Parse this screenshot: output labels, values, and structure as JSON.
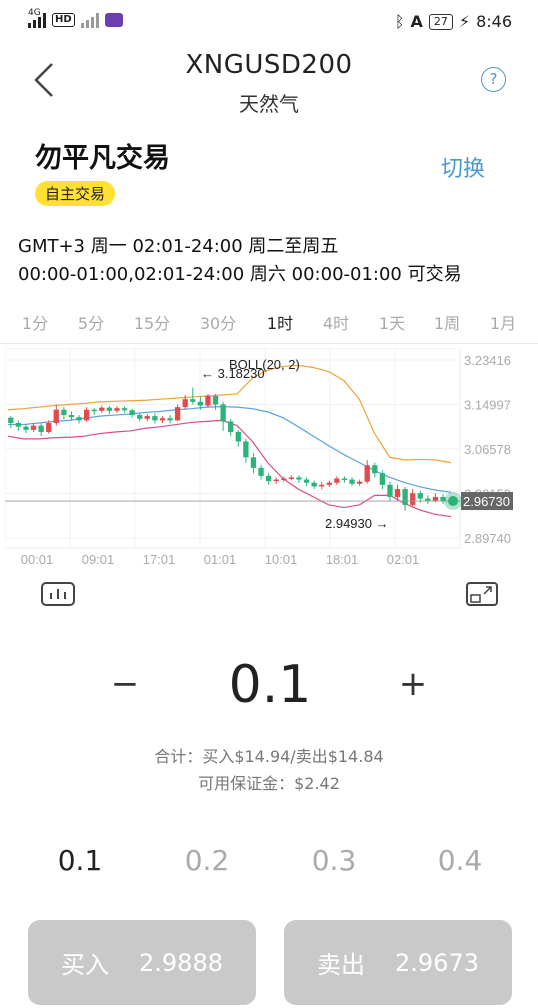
{
  "status_bar": {
    "network": "4G",
    "hd": "HD",
    "battery": "27",
    "time": "8:46"
  },
  "header": {
    "symbol": "XNGUSD200",
    "name": "天然气",
    "help": "?"
  },
  "instrument": {
    "title": "勿平凡交易",
    "switch_label": "切换",
    "badge": "自主交易",
    "hours_line1": "GMT+3 周一 02:01-24:00  周二至周五",
    "hours_line2": "00:00-01:00,02:01-24:00  周六 00:00-01:00 可交易"
  },
  "timeframes": [
    "1分",
    "5分",
    "15分",
    "30分",
    "1时",
    "4时",
    "1天",
    "1周",
    "1月"
  ],
  "active_timeframe": "1时",
  "chart_data": {
    "type": "candlestick",
    "indicator_label": "BOLL(20, 2)",
    "y_ticks": [
      "3.23416",
      "3.14997",
      "3.06578",
      "2.98159",
      "2.89740"
    ],
    "x_ticks": [
      "00:01",
      "09:01",
      "17:01",
      "01:01",
      "10:01",
      "18:01",
      "02:01"
    ],
    "high_annotation": "← 3.18230",
    "low_annotation": "2.94930 →",
    "current_price": "2.96730",
    "ylim": [
      2.8974,
      3.23416
    ],
    "colors": {
      "up": "#e24b4b",
      "down": "#2bb37a",
      "upper_band": "#f0a236",
      "middle_band": "#5aa2e0",
      "lower_band": "#d94c8a"
    },
    "candles": [
      [
        3.125,
        3.115,
        3.128,
        3.105
      ],
      [
        3.115,
        3.108,
        3.12,
        3.1
      ],
      [
        3.108,
        3.102,
        3.113,
        3.096
      ],
      [
        3.102,
        3.11,
        3.115,
        3.098
      ],
      [
        3.11,
        3.098,
        3.114,
        3.09
      ],
      [
        3.098,
        3.115,
        3.12,
        3.095
      ],
      [
        3.115,
        3.14,
        3.15,
        3.11
      ],
      [
        3.14,
        3.13,
        3.145,
        3.122
      ],
      [
        3.13,
        3.126,
        3.137,
        3.12
      ],
      [
        3.126,
        3.12,
        3.13,
        3.114
      ],
      [
        3.12,
        3.14,
        3.145,
        3.117
      ],
      [
        3.14,
        3.138,
        3.143,
        3.13
      ],
      [
        3.138,
        3.144,
        3.148,
        3.134
      ],
      [
        3.144,
        3.138,
        3.147,
        3.132
      ],
      [
        3.138,
        3.143,
        3.147,
        3.134
      ],
      [
        3.143,
        3.139,
        3.146,
        3.134
      ],
      [
        3.139,
        3.13,
        3.142,
        3.125
      ],
      [
        3.13,
        3.123,
        3.134,
        3.118
      ],
      [
        3.123,
        3.128,
        3.132,
        3.118
      ],
      [
        3.128,
        3.12,
        3.133,
        3.114
      ],
      [
        3.12,
        3.124,
        3.128,
        3.115
      ],
      [
        3.124,
        3.12,
        3.13,
        3.114
      ],
      [
        3.12,
        3.145,
        3.15,
        3.118
      ],
      [
        3.145,
        3.16,
        3.168,
        3.14
      ],
      [
        3.16,
        3.155,
        3.182,
        3.15
      ],
      [
        3.155,
        3.148,
        3.165,
        3.14
      ],
      [
        3.148,
        3.166,
        3.17,
        3.144
      ],
      [
        3.166,
        3.15,
        3.17,
        3.14
      ],
      [
        3.15,
        3.118,
        3.155,
        3.1
      ],
      [
        3.118,
        3.098,
        3.122,
        3.09
      ],
      [
        3.098,
        3.08,
        3.102,
        3.07
      ],
      [
        3.08,
        3.05,
        3.085,
        3.04
      ],
      [
        3.05,
        3.03,
        3.058,
        3.02
      ],
      [
        3.03,
        3.015,
        3.036,
        3.008
      ],
      [
        3.015,
        3.005,
        3.02,
        2.998
      ],
      [
        3.005,
        3.008,
        3.012,
        3.0
      ],
      [
        3.008,
        3.01,
        3.014,
        3.004
      ],
      [
        3.01,
        3.012,
        3.016,
        3.006
      ],
      [
        3.012,
        3.008,
        3.016,
        3.002
      ],
      [
        3.008,
        3.002,
        3.012,
        2.996
      ],
      [
        3.002,
        2.995,
        3.006,
        2.99
      ],
      [
        2.995,
        2.998,
        3.003,
        2.99
      ],
      [
        2.998,
        3.002,
        3.006,
        2.994
      ],
      [
        3.002,
        3.01,
        3.014,
        2.998
      ],
      [
        3.01,
        3.008,
        3.014,
        3.002
      ],
      [
        3.008,
        3.0,
        3.012,
        2.996
      ],
      [
        3.0,
        3.004,
        3.008,
        2.996
      ],
      [
        3.004,
        3.035,
        3.045,
        3.0
      ],
      [
        3.035,
        3.02,
        3.04,
        3.012
      ],
      [
        3.02,
        2.998,
        3.025,
        2.99
      ],
      [
        2.998,
        2.975,
        3.004,
        2.966
      ],
      [
        2.975,
        2.99,
        2.998,
        2.968
      ],
      [
        2.99,
        2.96,
        2.994,
        2.949
      ],
      [
        2.96,
        2.982,
        2.99,
        2.955
      ],
      [
        2.982,
        2.972,
        2.987,
        2.964
      ],
      [
        2.972,
        2.968,
        2.978,
        2.962
      ],
      [
        2.968,
        2.975,
        2.982,
        2.965
      ],
      [
        2.975,
        2.967,
        2.98,
        2.962
      ]
    ],
    "upper_band": [
      3.14,
      3.142,
      3.145,
      3.148,
      3.15,
      3.152,
      3.155,
      3.156,
      3.157,
      3.158,
      3.16,
      3.162,
      3.164,
      3.166,
      3.168,
      3.17,
      3.2,
      3.215,
      3.222,
      3.224,
      3.22,
      3.212,
      3.195,
      3.16,
      3.095,
      3.05,
      3.045,
      3.046,
      3.045,
      3.04
    ],
    "middle_band": [
      3.112,
      3.112,
      3.115,
      3.118,
      3.12,
      3.124,
      3.128,
      3.13,
      3.132,
      3.135,
      3.137,
      3.14,
      3.142,
      3.145,
      3.146,
      3.145,
      3.142,
      3.136,
      3.125,
      3.108,
      3.09,
      3.072,
      3.055,
      3.04,
      3.025,
      3.012,
      3.002,
      2.994,
      2.988,
      2.984
    ],
    "lower_band": [
      3.09,
      3.085,
      3.085,
      3.087,
      3.088,
      3.09,
      3.095,
      3.098,
      3.1,
      3.105,
      3.108,
      3.112,
      3.116,
      3.118,
      3.12,
      3.11,
      3.08,
      3.04,
      3.01,
      2.99,
      2.975,
      2.96,
      2.955,
      2.96,
      2.978,
      2.978,
      2.962,
      2.95,
      2.942,
      2.938
    ]
  },
  "order": {
    "minus": "−",
    "lot": "0.1",
    "plus": "+",
    "total": "合计：买入$14.94/卖出$14.84",
    "margin": "可用保证金：$2.42",
    "presets": [
      "0.1",
      "0.2",
      "0.3",
      "0.4"
    ],
    "active_preset": "0.1",
    "buy_label": "买入",
    "buy_price": "2.9888",
    "sell_label": "卖出",
    "sell_price": "2.9673"
  }
}
